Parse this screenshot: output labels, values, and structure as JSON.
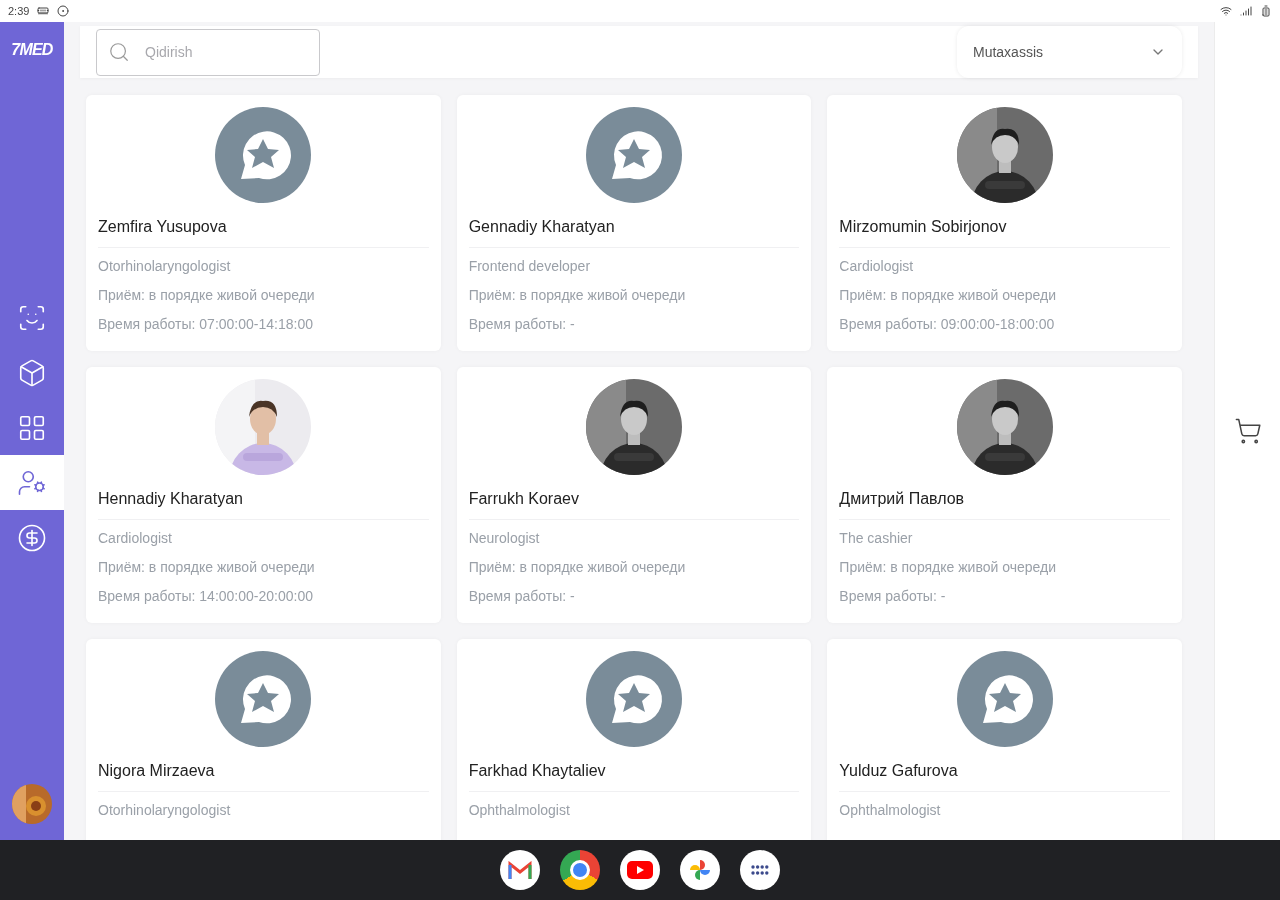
{
  "status_bar": {
    "time": "2:39"
  },
  "sidebar": {
    "logo": "7MED",
    "items": [
      {
        "selected": false
      },
      {
        "selected": false
      },
      {
        "selected": false
      },
      {
        "selected": true
      },
      {
        "selected": false
      }
    ]
  },
  "search": {
    "placeholder": "Qidirish"
  },
  "filter": {
    "value": "Mutaxassis"
  },
  "doctors": [
    {
      "kind": "placeholder",
      "name": "Zemfira Yusupova",
      "specialty": "Otorhinolaryngologist",
      "queue": "Приём: в порядке живой очереди",
      "hours": "Время работы: 07:00:00-14:18:00"
    },
    {
      "kind": "placeholder",
      "name": "Gennadiy Kharatyan",
      "specialty": "Frontend developer",
      "queue": "Приём: в порядке живой очереди",
      "hours": "Время работы: -"
    },
    {
      "name": "Mirzomumin Sobirjonov",
      "specialty": "Cardiologist",
      "queue": "Приём: в порядке живой очереди",
      "hours": "Время работы: 09:00:00-18:00:00"
    },
    {
      "name": "Hennadiy Kharatyan",
      "specialty": "Cardiologist",
      "queue": "Приём: в порядке живой очереди",
      "hours": "Время работы: 14:00:00-20:00:00"
    },
    {
      "name": "Farrukh Koraev",
      "specialty": "Neurologist",
      "queue": "Приём: в порядке живой очереди",
      "hours": "Время работы: -"
    },
    {
      "name": "Дмитрий Павлов",
      "specialty": "The cashier",
      "queue": "Приём: в порядке живой очереди",
      "hours": "Время работы: -"
    },
    {
      "kind": "placeholder",
      "name": "Nigora Mirzaeva",
      "specialty": "Otorhinolaryngologist"
    },
    {
      "kind": "placeholder",
      "name": "Farkhad Khaytaliev",
      "specialty": "Ophthalmologist"
    },
    {
      "kind": "placeholder",
      "name": "Yulduz Gafurova",
      "specialty": "Ophthalmologist"
    }
  ]
}
